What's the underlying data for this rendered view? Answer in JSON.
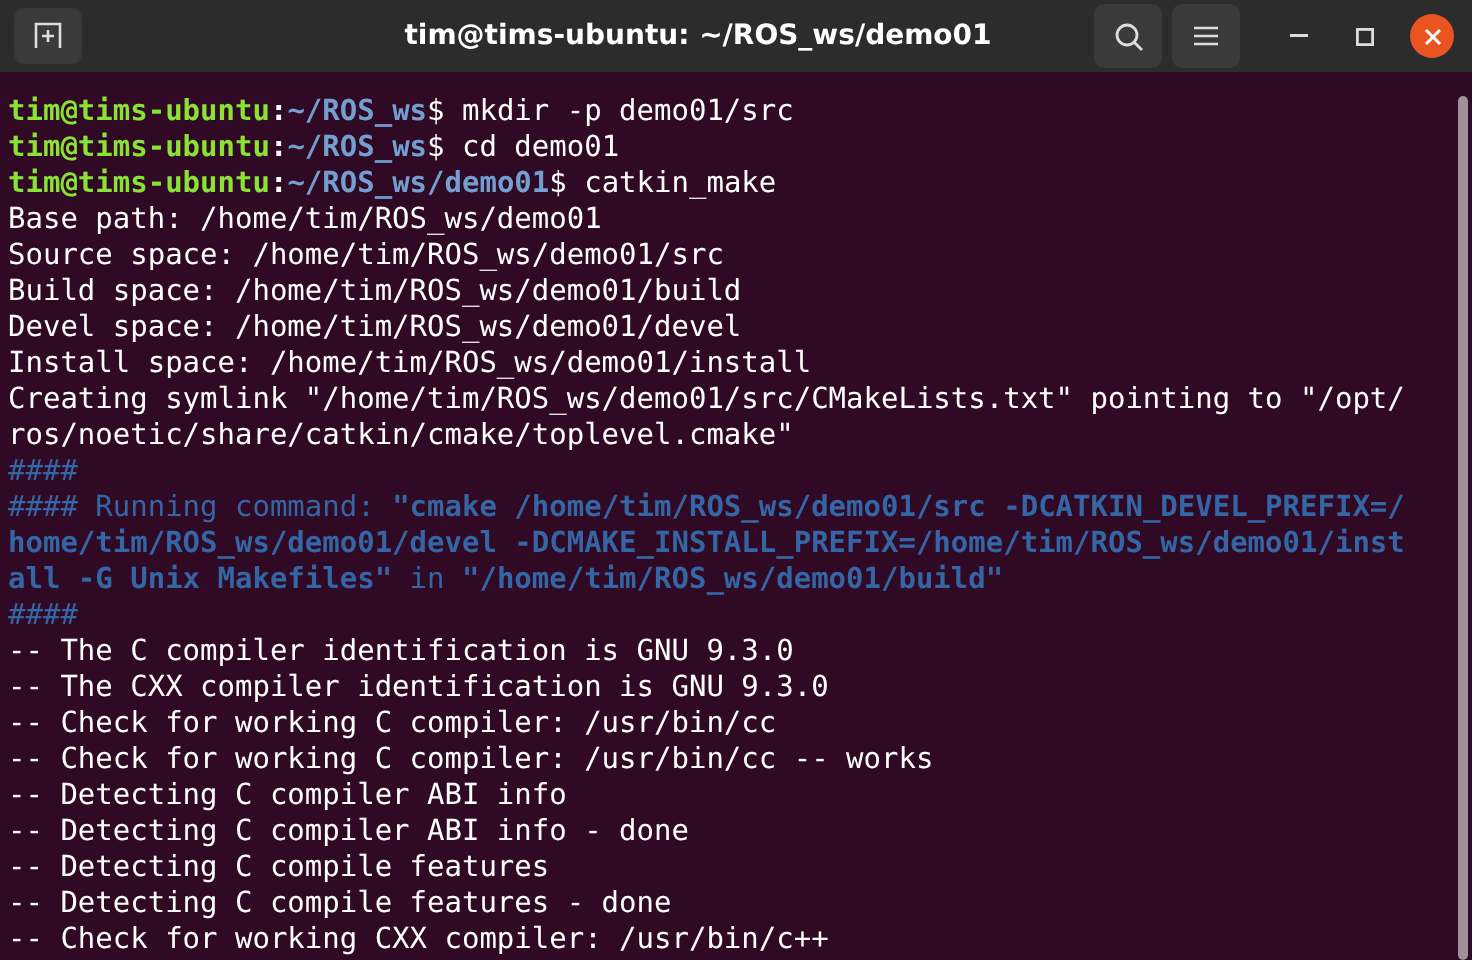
{
  "window": {
    "title": "tim@tims-ubuntu: ~/ROS_ws/demo01"
  },
  "lines": [
    [
      {
        "kind": "user",
        "text": "tim@tims-ubuntu"
      },
      {
        "kind": "sep",
        "text": ":"
      },
      {
        "kind": "path",
        "text": "~/ROS_ws"
      },
      {
        "kind": "plain",
        "text": "$ mkdir -p demo01/src"
      }
    ],
    [
      {
        "kind": "user",
        "text": "tim@tims-ubuntu"
      },
      {
        "kind": "sep",
        "text": ":"
      },
      {
        "kind": "path",
        "text": "~/ROS_ws"
      },
      {
        "kind": "plain",
        "text": "$ cd demo01"
      }
    ],
    [
      {
        "kind": "user",
        "text": "tim@tims-ubuntu"
      },
      {
        "kind": "sep",
        "text": ":"
      },
      {
        "kind": "path",
        "text": "~/ROS_ws/demo01"
      },
      {
        "kind": "plain",
        "text": "$ catkin_make"
      }
    ],
    [
      {
        "kind": "plain",
        "text": "Base path: /home/tim/ROS_ws/demo01"
      }
    ],
    [
      {
        "kind": "plain",
        "text": "Source space: /home/tim/ROS_ws/demo01/src"
      }
    ],
    [
      {
        "kind": "plain",
        "text": "Build space: /home/tim/ROS_ws/demo01/build"
      }
    ],
    [
      {
        "kind": "plain",
        "text": "Devel space: /home/tim/ROS_ws/demo01/devel"
      }
    ],
    [
      {
        "kind": "plain",
        "text": "Install space: /home/tim/ROS_ws/demo01/install"
      }
    ],
    [
      {
        "kind": "plain",
        "text": "Creating symlink \"/home/tim/ROS_ws/demo01/src/CMakeLists.txt\" pointing to \"/opt/"
      }
    ],
    [
      {
        "kind": "plain",
        "text": "ros/noetic/share/catkin/cmake/toplevel.cmake\""
      }
    ],
    [
      {
        "kind": "info",
        "text": "####"
      }
    ],
    [
      {
        "kind": "info",
        "text": "#### Running command: "
      },
      {
        "kind": "info-bold",
        "text": "\"cmake /home/tim/ROS_ws/demo01/src -DCATKIN_DEVEL_PREFIX=/"
      }
    ],
    [
      {
        "kind": "info-bold",
        "text": "home/tim/ROS_ws/demo01/devel -DCMAKE_INSTALL_PREFIX=/home/tim/ROS_ws/demo01/inst"
      }
    ],
    [
      {
        "kind": "info-bold",
        "text": "all -G Unix Makefiles\""
      },
      {
        "kind": "info",
        "text": " in "
      },
      {
        "kind": "info-bold",
        "text": "\"/home/tim/ROS_ws/demo01/build\""
      }
    ],
    [
      {
        "kind": "info",
        "text": "####"
      }
    ],
    [
      {
        "kind": "plain",
        "text": "-- The C compiler identification is GNU 9.3.0"
      }
    ],
    [
      {
        "kind": "plain",
        "text": "-- The CXX compiler identification is GNU 9.3.0"
      }
    ],
    [
      {
        "kind": "plain",
        "text": "-- Check for working C compiler: /usr/bin/cc"
      }
    ],
    [
      {
        "kind": "plain",
        "text": "-- Check for working C compiler: /usr/bin/cc -- works"
      }
    ],
    [
      {
        "kind": "plain",
        "text": "-- Detecting C compiler ABI info"
      }
    ],
    [
      {
        "kind": "plain",
        "text": "-- Detecting C compiler ABI info - done"
      }
    ],
    [
      {
        "kind": "plain",
        "text": "-- Detecting C compile features"
      }
    ],
    [
      {
        "kind": "plain",
        "text": "-- Detecting C compile features - done"
      }
    ],
    [
      {
        "kind": "plain",
        "text": "-- Check for working CXX compiler: /usr/bin/c++"
      }
    ]
  ]
}
